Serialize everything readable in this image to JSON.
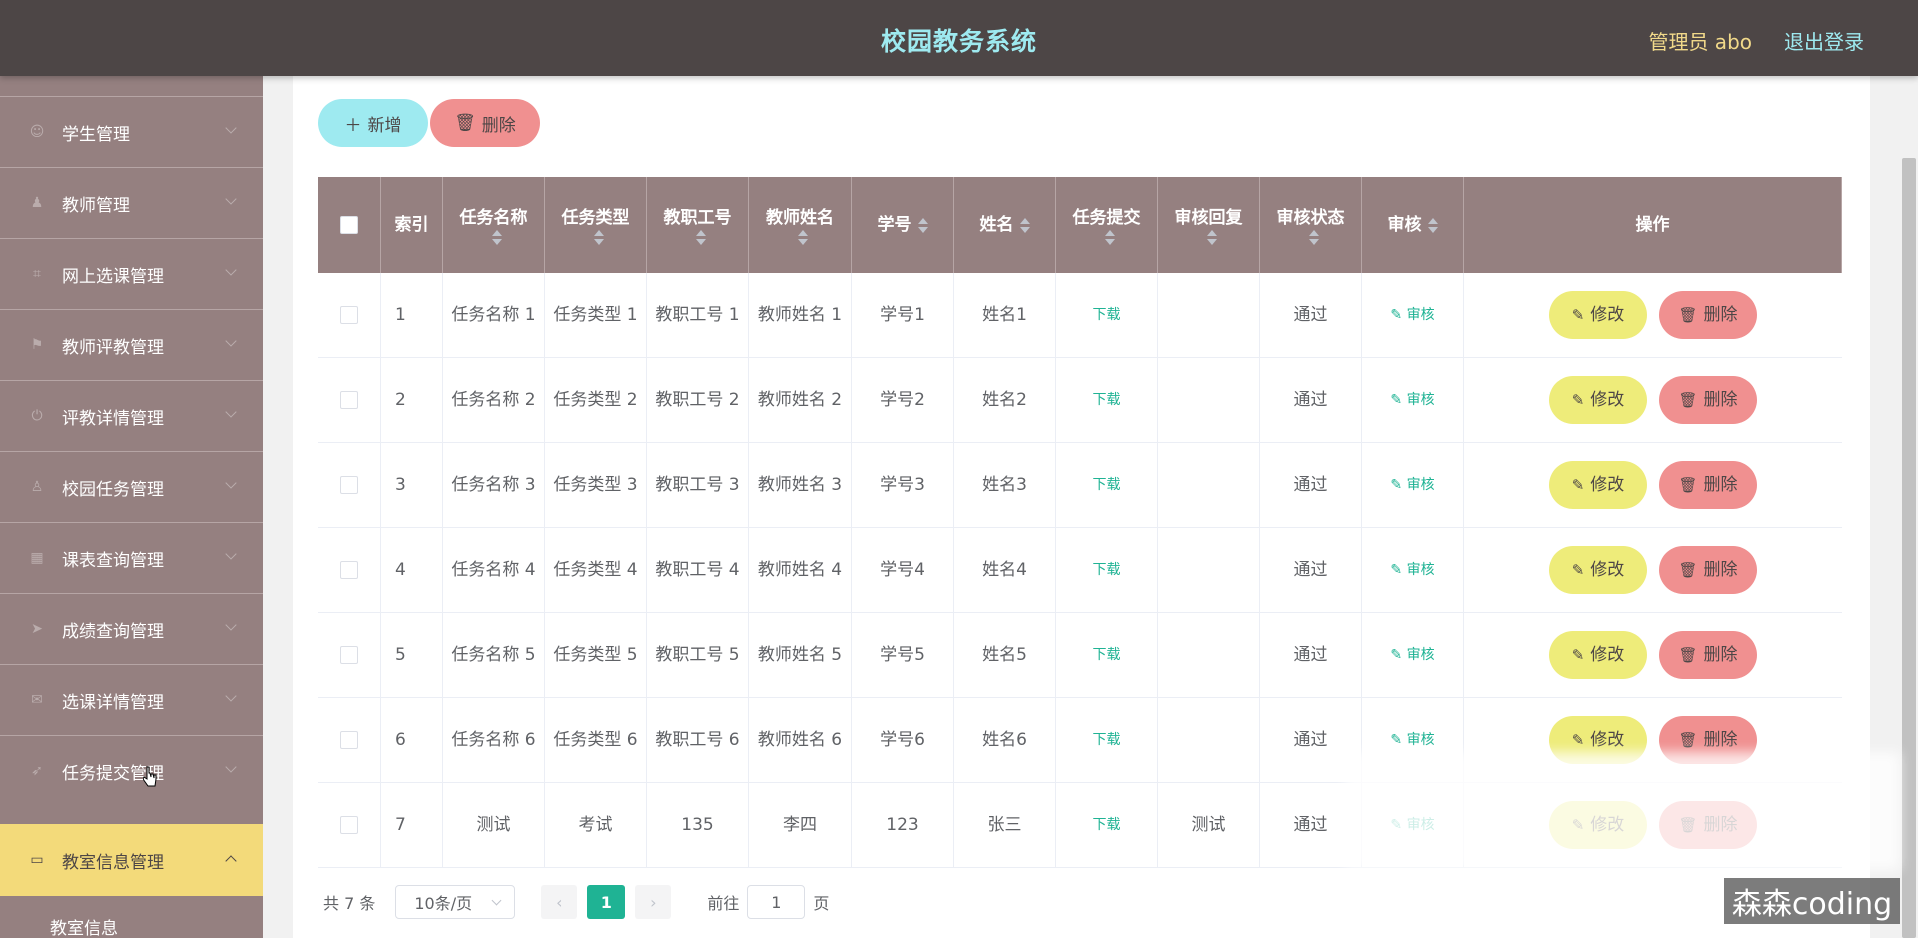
{
  "header": {
    "title": "校园教务系统",
    "admin": "管理员 abo",
    "logout": "退出登录"
  },
  "sidebar": {
    "items": [
      {
        "label": "学生管理",
        "icon": "user-icon"
      },
      {
        "label": "教师管理",
        "icon": "teacher-icon"
      },
      {
        "label": "网上选课管理",
        "icon": "crop-icon"
      },
      {
        "label": "教师评教管理",
        "icon": "flag-icon"
      },
      {
        "label": "评教详情管理",
        "icon": "power-icon"
      },
      {
        "label": "校园任务管理",
        "icon": "person-icon"
      },
      {
        "label": "课表查询管理",
        "icon": "grid-icon"
      },
      {
        "label": "成绩查询管理",
        "icon": "send-icon"
      },
      {
        "label": "选课详情管理",
        "icon": "mail-icon"
      },
      {
        "label": "任务提交管理",
        "icon": "navigate-icon"
      }
    ],
    "active": {
      "label": "教室信息管理",
      "icon": "chat-icon"
    },
    "submenu": "教室信息"
  },
  "toolbar": {
    "add": "新增",
    "delete": "删除"
  },
  "table": {
    "headers": [
      "索引",
      "任务名称",
      "任务类型",
      "教职工号",
      "教师姓名",
      "学号",
      "姓名",
      "任务提交",
      "审核回复",
      "审核状态",
      "审核",
      "操作"
    ],
    "rows": [
      {
        "idx": "1",
        "name": "任务名称 1",
        "type": "任务类型 1",
        "tid": "教职工号 1",
        "tname": "教师姓名 1",
        "sid": "学号1",
        "sname": "姓名1",
        "submit": "下载",
        "reply": "",
        "status": "通过",
        "audit": "审核"
      },
      {
        "idx": "2",
        "name": "任务名称 2",
        "type": "任务类型 2",
        "tid": "教职工号 2",
        "tname": "教师姓名 2",
        "sid": "学号2",
        "sname": "姓名2",
        "submit": "下载",
        "reply": "",
        "status": "通过",
        "audit": "审核"
      },
      {
        "idx": "3",
        "name": "任务名称 3",
        "type": "任务类型 3",
        "tid": "教职工号 3",
        "tname": "教师姓名 3",
        "sid": "学号3",
        "sname": "姓名3",
        "submit": "下载",
        "reply": "",
        "status": "通过",
        "audit": "审核"
      },
      {
        "idx": "4",
        "name": "任务名称 4",
        "type": "任务类型 4",
        "tid": "教职工号 4",
        "tname": "教师姓名 4",
        "sid": "学号4",
        "sname": "姓名4",
        "submit": "下载",
        "reply": "",
        "status": "通过",
        "audit": "审核"
      },
      {
        "idx": "5",
        "name": "任务名称 5",
        "type": "任务类型 5",
        "tid": "教职工号 5",
        "tname": "教师姓名 5",
        "sid": "学号5",
        "sname": "姓名5",
        "submit": "下载",
        "reply": "",
        "status": "通过",
        "audit": "审核"
      },
      {
        "idx": "6",
        "name": "任务名称 6",
        "type": "任务类型 6",
        "tid": "教职工号 6",
        "tname": "教师姓名 6",
        "sid": "学号6",
        "sname": "姓名6",
        "submit": "下载",
        "reply": "",
        "status": "通过",
        "audit": "审核"
      },
      {
        "idx": "7",
        "name": "测试",
        "type": "考试",
        "tid": "135",
        "tname": "李四",
        "sid": "123",
        "sname": "张三",
        "submit": "下载",
        "reply": "测试",
        "status": "通过",
        "audit": "审核"
      }
    ],
    "edit": "修改",
    "delete": "删除"
  },
  "pagination": {
    "total": "共 7 条",
    "page_size": "10条/页",
    "current": "1",
    "goto_prefix": "前往",
    "goto_value": "1",
    "goto_suffix": "页"
  },
  "watermark": "森森coding",
  "colors": {
    "header_bg": "#4d4646",
    "sidebar_bg": "#958080",
    "accent": "#9eeaf0",
    "active_menu": "#f3da7a",
    "danger": "#f09090",
    "edit": "#eeec7a",
    "link": "#1fb394"
  }
}
